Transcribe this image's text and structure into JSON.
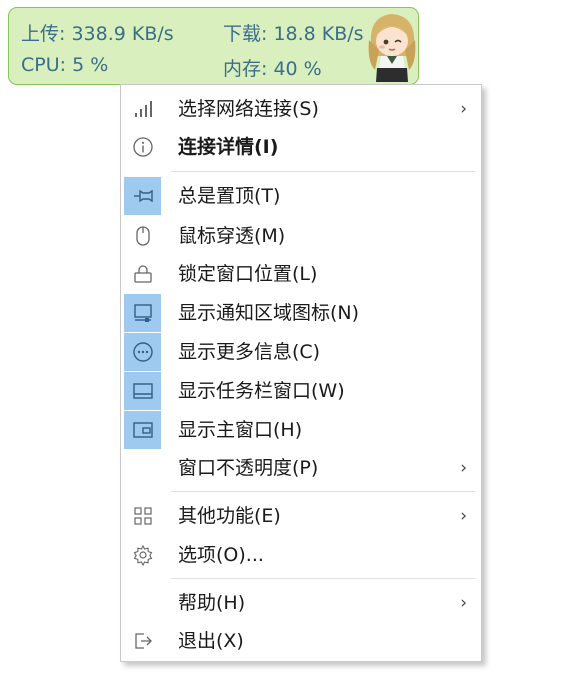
{
  "widget": {
    "upload_label": "上传: 338.9 KB/s",
    "download_label": "下载: 18.8 KB/s",
    "cpu_label": "CPU: 5 %",
    "memory_label": "内存: 40 %"
  },
  "menu": {
    "items": [
      {
        "label": "选择网络连接(S)",
        "icon": "signal-bars-icon",
        "submenu": true,
        "checked": false,
        "bold": false
      },
      {
        "label": "连接详情(I)",
        "icon": "info-icon",
        "submenu": false,
        "checked": false,
        "bold": true
      },
      {
        "label": "总是置顶(T)",
        "icon": "pin-icon",
        "submenu": false,
        "checked": true,
        "bold": false
      },
      {
        "label": "鼠标穿透(M)",
        "icon": "mouse-icon",
        "submenu": false,
        "checked": false,
        "bold": false
      },
      {
        "label": "锁定窗口位置(L)",
        "icon": "lock-icon",
        "submenu": false,
        "checked": false,
        "bold": false
      },
      {
        "label": "显示通知区域图标(N)",
        "icon": "notification-area-icon",
        "submenu": false,
        "checked": true,
        "bold": false
      },
      {
        "label": "显示更多信息(C)",
        "icon": "more-info-icon",
        "submenu": false,
        "checked": true,
        "bold": false
      },
      {
        "label": "显示任务栏窗口(W)",
        "icon": "taskbar-window-icon",
        "submenu": false,
        "checked": true,
        "bold": false
      },
      {
        "label": "显示主窗口(H)",
        "icon": "main-window-icon",
        "submenu": false,
        "checked": true,
        "bold": false
      },
      {
        "label": "窗口不透明度(P)",
        "icon": "",
        "submenu": true,
        "checked": false,
        "bold": false
      },
      {
        "label": "其他功能(E)",
        "icon": "grid-icon",
        "submenu": true,
        "checked": false,
        "bold": false
      },
      {
        "label": "选项(O)...",
        "icon": "gear-icon",
        "submenu": false,
        "checked": false,
        "bold": false
      },
      {
        "label": "帮助(H)",
        "icon": "",
        "submenu": true,
        "checked": false,
        "bold": false
      },
      {
        "label": "退出(X)",
        "icon": "exit-icon",
        "submenu": false,
        "checked": false,
        "bold": false
      }
    ],
    "submenu_arrow": "›"
  },
  "colors": {
    "widget_bg": "#d9efbe",
    "widget_border": "#86c55a",
    "widget_text": "#3a6e8a",
    "checked_bg": "#9fcaf0"
  }
}
